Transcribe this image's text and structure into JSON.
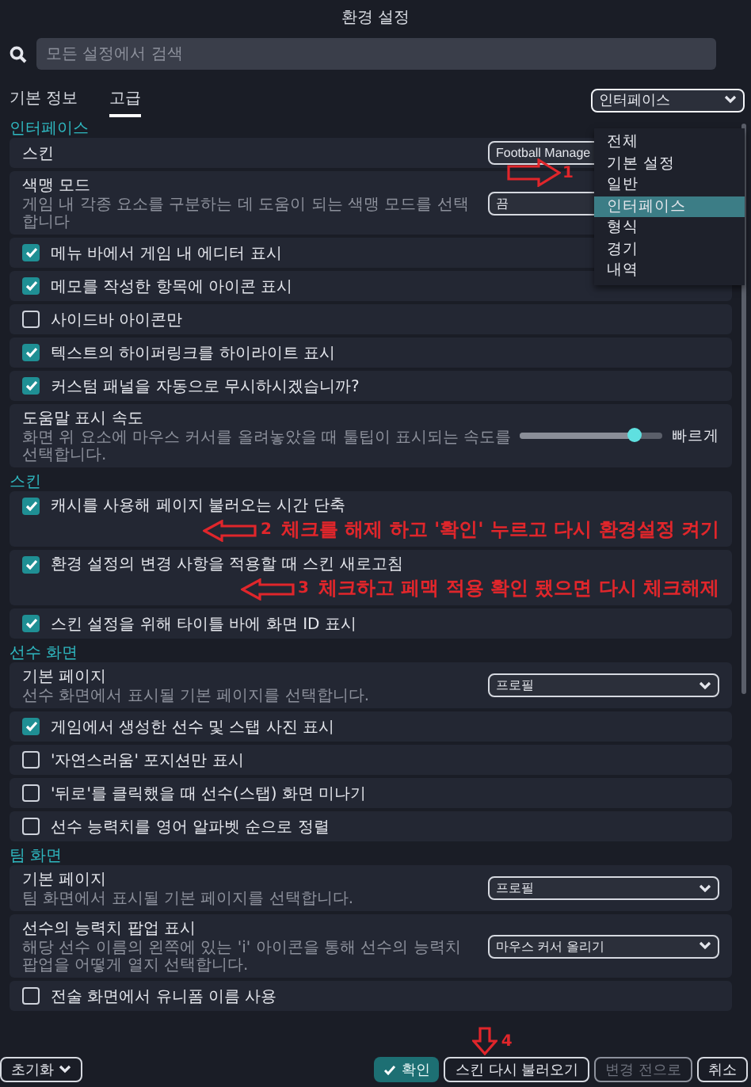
{
  "window": {
    "title": "환경 설정"
  },
  "search": {
    "placeholder": "모든 설정에서 검색"
  },
  "tabs": [
    {
      "label": "기본 정보",
      "selected": false
    },
    {
      "label": "고급",
      "selected": true
    }
  ],
  "category_select": {
    "value": "인터페이스",
    "expanded": true,
    "options": [
      {
        "label": "전체",
        "selected": false
      },
      {
        "label": "기본 설정",
        "selected": false
      },
      {
        "label": "일반",
        "selected": false
      },
      {
        "label": "인터페이스",
        "selected": true
      },
      {
        "label": "형식",
        "selected": false
      },
      {
        "label": "경기",
        "selected": false
      },
      {
        "label": "내역",
        "selected": false
      }
    ]
  },
  "sections": [
    {
      "title": "인터페이스",
      "items": [
        {
          "kind": "select",
          "label": "스킨",
          "value": "Football Manage",
          "annotation": {
            "kind": "right",
            "number": "1"
          }
        },
        {
          "kind": "select",
          "label": "색맹 모드",
          "description": "게임 내 각종 요소를 구분하는 데 도움이 되는 색맹 모드를 선택합니다",
          "value": "끔"
        },
        {
          "kind": "checkbox",
          "label": "메뉴 바에서 게임 내 에디터 표시",
          "checked": true
        },
        {
          "kind": "checkbox",
          "label": "메모를 작성한 항목에 아이콘 표시",
          "checked": true
        },
        {
          "kind": "checkbox",
          "label": "사이드바 아이콘만",
          "checked": false
        },
        {
          "kind": "checkbox",
          "label": "텍스트의 하이퍼링크를 하이라이트 표시",
          "checked": true
        },
        {
          "kind": "checkbox",
          "label": "커스텀 패널을 자동으로 무시하시겠습니까?",
          "checked": true
        },
        {
          "kind": "slider",
          "label": "도움말 표시 속도",
          "description": "화면 위 요소에 마우스 커서를 올려놓았을 때 툴팁이 표시되는 속도를 선택합니다.",
          "level": 0.8,
          "reading": "빠르게"
        }
      ]
    },
    {
      "title": "스킨",
      "items": [
        {
          "kind": "checkbox",
          "label": "캐시를 사용해 페이지 불러오는 시간 단축",
          "checked": true,
          "annotation": {
            "kind": "left",
            "number": "2",
            "note": "체크를 해제 하고 '확인' 누르고 다시 환경설정 켜기"
          }
        },
        {
          "kind": "checkbox",
          "label": "환경 설정의 변경 사항을 적용할 때 스킨 새로고침",
          "checked": true,
          "annotation": {
            "kind": "left",
            "number": "3",
            "note": "체크하고 페맥 적용 확인 됐으면 다시 체크해제"
          }
        },
        {
          "kind": "checkbox",
          "label": "스킨 설정을 위해 타이틀 바에 화면 ID 표시",
          "checked": true
        }
      ]
    },
    {
      "title": "선수 화면",
      "items": [
        {
          "kind": "select",
          "label": "기본 페이지",
          "description": "선수 화면에서 표시될 기본 페이지를 선택합니다.",
          "value": "프로필"
        },
        {
          "kind": "checkbox",
          "label": "게임에서 생성한 선수 및 스탭 사진 표시",
          "checked": true
        },
        {
          "kind": "checkbox",
          "label": "'자연스러움' 포지션만 표시",
          "checked": false
        },
        {
          "kind": "checkbox",
          "label": "'뒤로'를 클릭했을 때 선수(스탭) 화면 미나기",
          "checked": false
        },
        {
          "kind": "checkbox",
          "label": "선수 능력치를 영어 알파벳 순으로 정렬",
          "checked": false
        }
      ]
    },
    {
      "title": "팀 화면",
      "items": [
        {
          "kind": "select",
          "label": "기본 페이지",
          "description": "팀 화면에서 표시될 기본 페이지를 선택합니다.",
          "value": "프로필"
        },
        {
          "kind": "select",
          "label": "선수의 능력치 팝업 표시",
          "description": "해당 선수 이름의 왼쪽에 있는 'i' 아이콘을 통해 선수의 능력치 팝업을 어떻게 열지 선택합니다.",
          "value": "마우스 커서 올리기"
        },
        {
          "kind": "checkbox",
          "label": "전술 화면에서 유니폼 이름 사용",
          "checked": false
        }
      ]
    }
  ],
  "footer": {
    "reset": "초기화",
    "buttons": [
      {
        "label": "확인",
        "kind": "primary"
      },
      {
        "label": "스킨 다시 불러오기",
        "kind": "outline",
        "annotation": {
          "kind": "down",
          "number": "4"
        }
      },
      {
        "label": "변경 전으로",
        "kind": "disabled"
      },
      {
        "label": "취소",
        "kind": "outline"
      }
    ]
  }
}
